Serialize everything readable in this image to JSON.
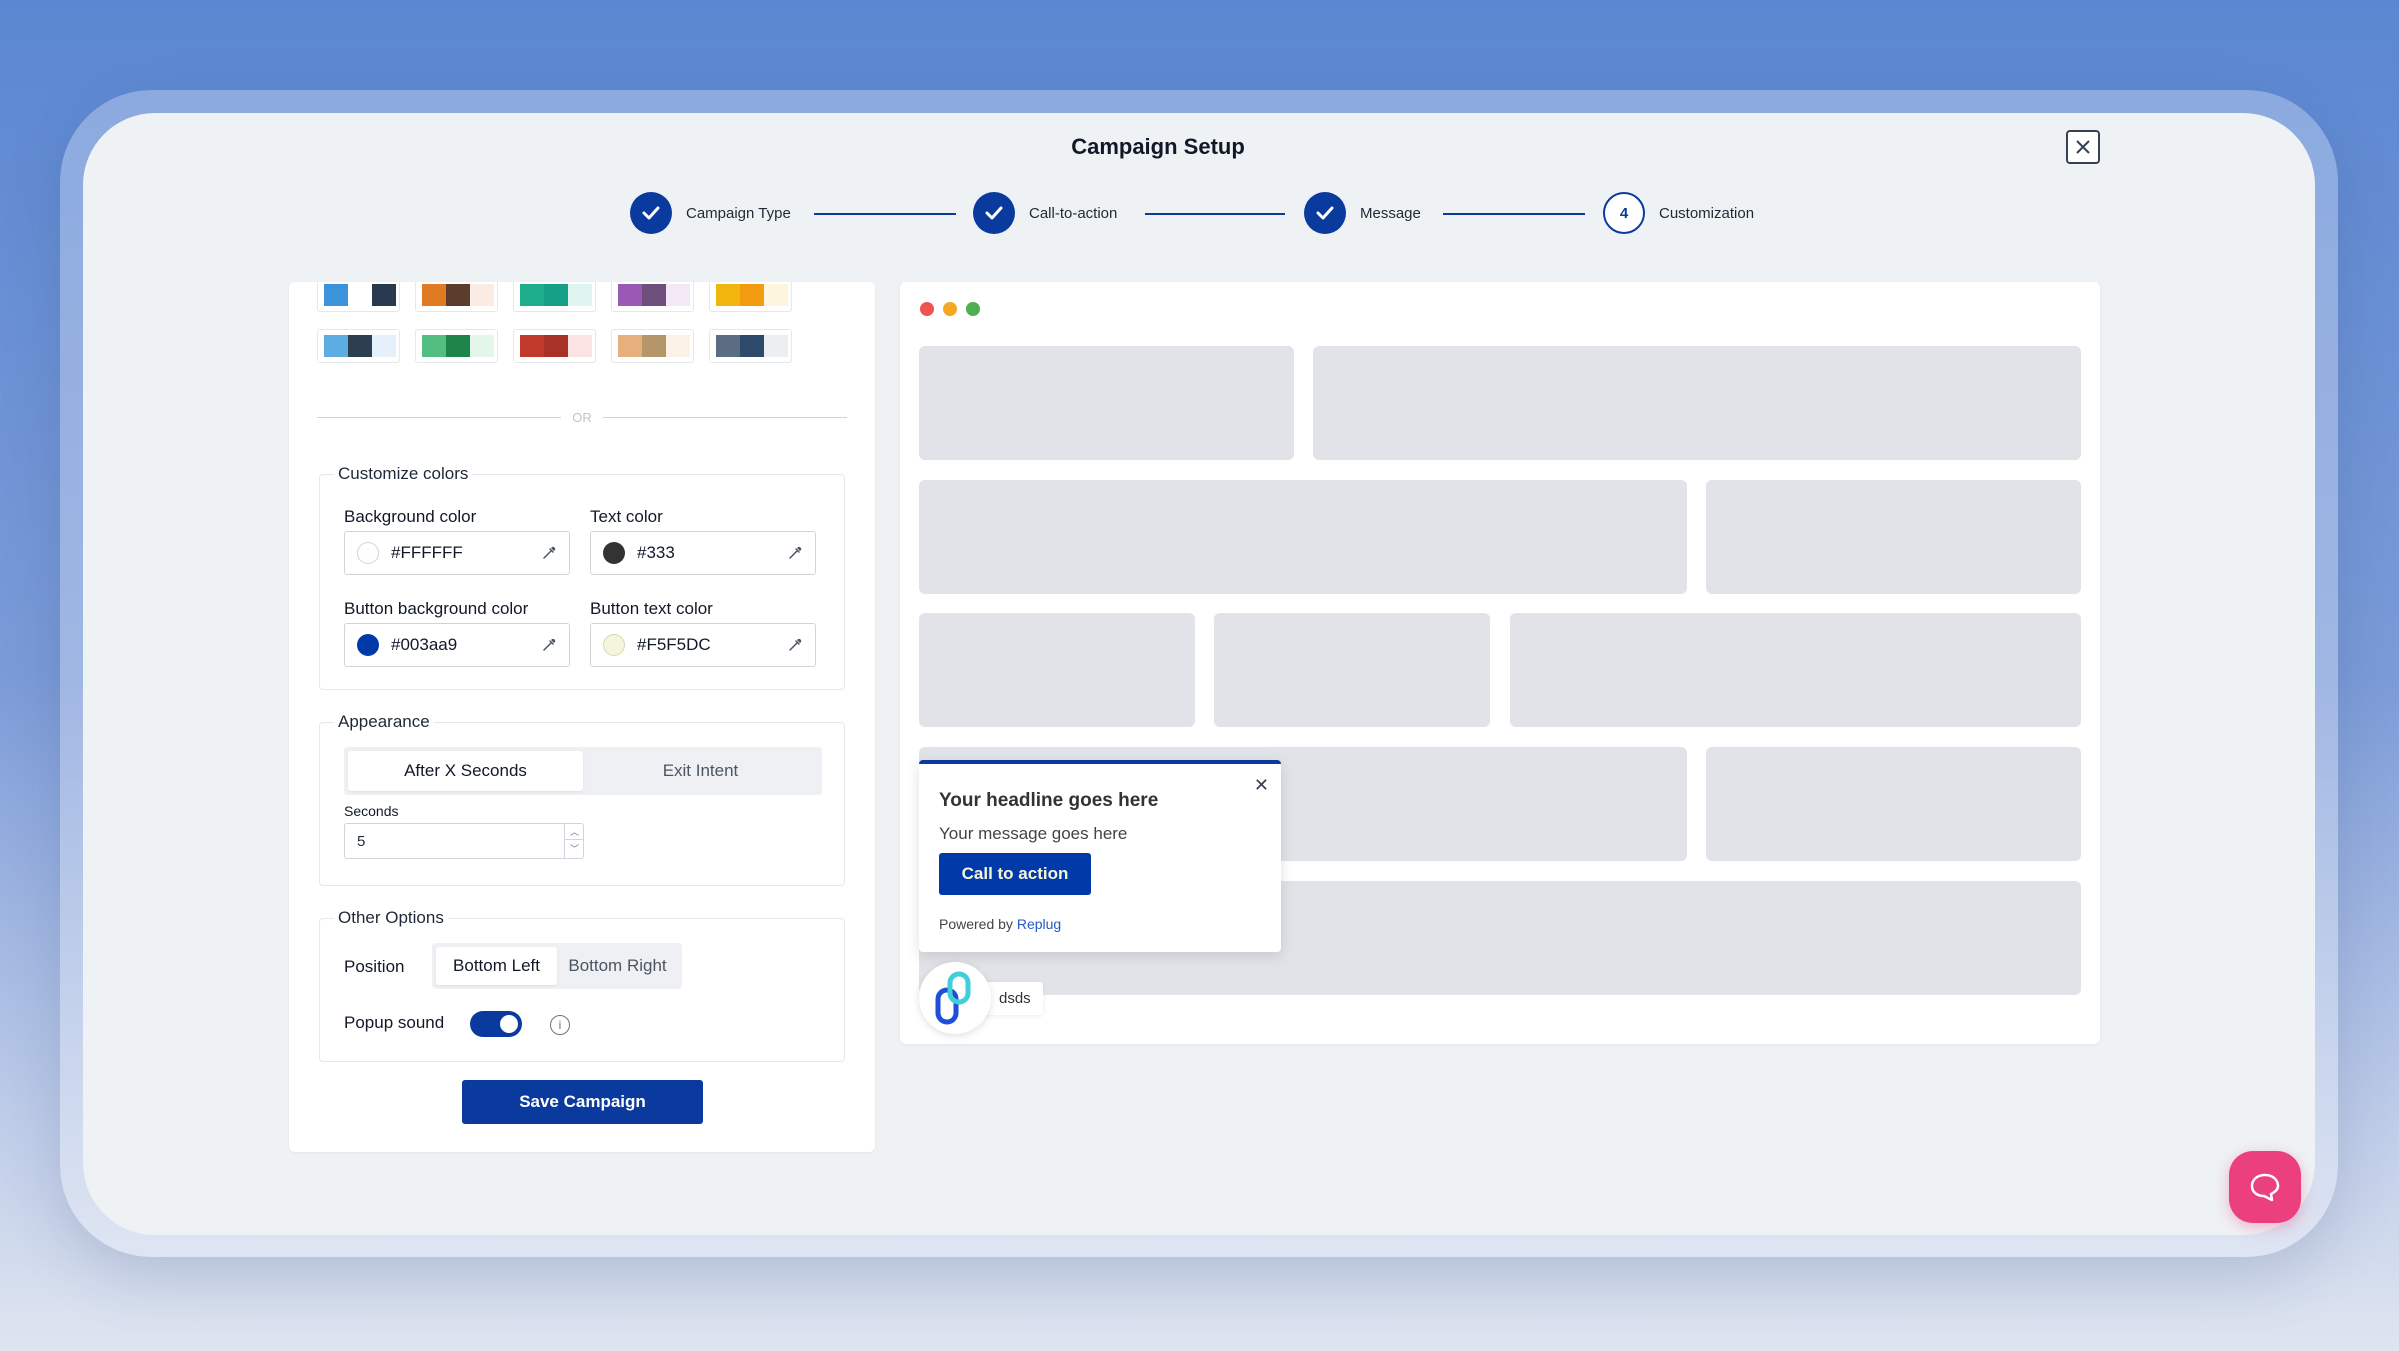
{
  "modal": {
    "title": "Campaign Setup"
  },
  "stepper": {
    "steps": [
      {
        "label": "Campaign Type",
        "state": "done"
      },
      {
        "label": "Call-to-action",
        "state": "done"
      },
      {
        "label": "Message",
        "state": "done"
      },
      {
        "label": "Customization",
        "state": "current",
        "number": "4"
      }
    ]
  },
  "themes": {
    "row1": [
      [
        "#3b93dc",
        "#ffffff",
        "#2a3a4e"
      ],
      [
        "#e07a23",
        "#5a3e2b",
        "#fbece3"
      ],
      [
        "#1fae8c",
        "#16a085",
        "#dff5ef"
      ],
      [
        "#9b59b6",
        "#6c4f7d",
        "#f3e8f6"
      ],
      [
        "#f1b70e",
        "#f39c12",
        "#fef6dc"
      ]
    ],
    "row2": [
      [
        "#5dade2",
        "#2c3e50",
        "#e6f0fa"
      ],
      [
        "#52be80",
        "#1e8449",
        "#e4f5ea"
      ],
      [
        "#c0392b",
        "#a93226",
        "#fbe3e3"
      ],
      [
        "#e6b07c",
        "#b5956a",
        "#fbf1e6"
      ],
      [
        "#5a6d82",
        "#2e4a6b",
        "#eceff2"
      ]
    ],
    "or_text": "OR"
  },
  "customize_colors": {
    "legend": "Customize colors",
    "background_color": {
      "label": "Background color",
      "value": "#FFFFFF",
      "swatch": "#ffffff"
    },
    "text_color": {
      "label": "Text color",
      "value": "#333",
      "swatch": "#333333"
    },
    "button_background_color": {
      "label": "Button background color",
      "value": "#003aa9",
      "swatch": "#003aa9"
    },
    "button_text_color": {
      "label": "Button text color",
      "value": "#F5F5DC",
      "swatch": "#F5F5DC"
    }
  },
  "appearance": {
    "legend": "Appearance",
    "options": [
      "After X Seconds",
      "Exit Intent"
    ],
    "selected": "After X Seconds",
    "seconds_label": "Seconds",
    "seconds_value": "5"
  },
  "other_options": {
    "legend": "Other Options",
    "position_label": "Position",
    "positions": [
      "Bottom Left",
      "Bottom Right"
    ],
    "selected_position": "Bottom Left",
    "popup_sound_label": "Popup sound",
    "popup_sound_on": true,
    "info_icon": "i"
  },
  "save_label": "Save Campaign",
  "preview": {
    "window_dots": [
      "#ef5350",
      "#f5a623",
      "#4caf50"
    ],
    "popup": {
      "close": "✕",
      "headline": "Your headline goes here",
      "message": "Your message goes here",
      "cta": "Call to action",
      "powered_prefix": "Powered by",
      "powered_link": "Replug"
    },
    "avatar_name": "dsds"
  },
  "colors": {
    "primary": "#0a3a9e",
    "chat": "#ec3f7d"
  }
}
